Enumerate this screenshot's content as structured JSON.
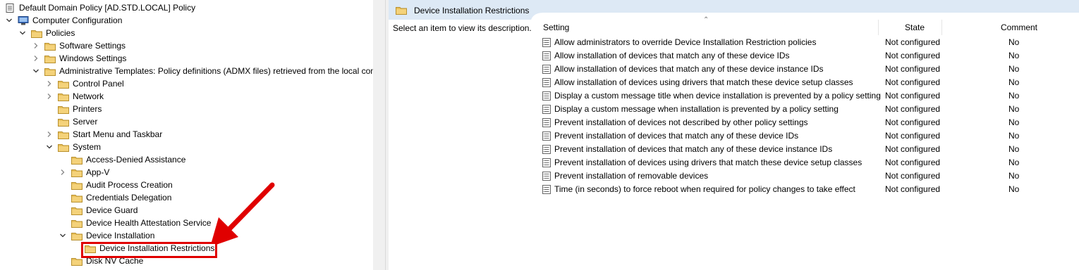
{
  "tree": {
    "items": [
      {
        "label": "Default Domain Policy [AD.STD.LOCAL] Policy",
        "icon": "policy-doc-icon",
        "expander": "none",
        "name": "tree-item-default-domain-policy"
      },
      {
        "label": "Computer Configuration",
        "icon": "computer-icon",
        "expander": "open",
        "name": "tree-item-computer-configuration"
      },
      {
        "label": "Policies",
        "icon": "folder-icon",
        "expander": "open",
        "name": "tree-item-policies"
      },
      {
        "label": "Software Settings",
        "icon": "folder-icon",
        "expander": "closed",
        "name": "tree-item-software-settings"
      },
      {
        "label": "Windows Settings",
        "icon": "folder-icon",
        "expander": "closed",
        "name": "tree-item-windows-settings"
      },
      {
        "label": "Administrative Templates: Policy definitions (ADMX files) retrieved from the local computer",
        "icon": "folder-icon",
        "expander": "open",
        "name": "tree-item-administrative-templates"
      },
      {
        "label": "Control Panel",
        "icon": "folder-icon",
        "expander": "closed",
        "name": "tree-item-control-panel"
      },
      {
        "label": "Network",
        "icon": "folder-icon",
        "expander": "closed",
        "name": "tree-item-network"
      },
      {
        "label": "Printers",
        "icon": "folder-icon",
        "expander": "none",
        "name": "tree-item-printers"
      },
      {
        "label": "Server",
        "icon": "folder-icon",
        "expander": "none",
        "name": "tree-item-server"
      },
      {
        "label": "Start Menu and Taskbar",
        "icon": "folder-icon",
        "expander": "closed",
        "name": "tree-item-start-menu"
      },
      {
        "label": "System",
        "icon": "folder-icon",
        "expander": "open",
        "name": "tree-item-system"
      },
      {
        "label": "Access-Denied Assistance",
        "icon": "folder-icon",
        "expander": "none",
        "name": "tree-item-access-denied"
      },
      {
        "label": "App-V",
        "icon": "folder-icon",
        "expander": "closed",
        "name": "tree-item-app-v"
      },
      {
        "label": "Audit Process Creation",
        "icon": "folder-icon",
        "expander": "none",
        "name": "tree-item-audit-process"
      },
      {
        "label": "Credentials Delegation",
        "icon": "folder-icon",
        "expander": "none",
        "name": "tree-item-credentials-delegation"
      },
      {
        "label": "Device Guard",
        "icon": "folder-icon",
        "expander": "none",
        "name": "tree-item-device-guard"
      },
      {
        "label": "Device Health Attestation Service",
        "icon": "folder-icon",
        "expander": "none",
        "name": "tree-item-device-health"
      },
      {
        "label": "Device Installation",
        "icon": "folder-icon",
        "expander": "open",
        "name": "tree-item-device-installation"
      },
      {
        "label": "Device Installation Restrictions",
        "icon": "folder-icon",
        "expander": "none",
        "name": "tree-item-device-installation-restrictions"
      },
      {
        "label": "Disk NV Cache",
        "icon": "folder-icon",
        "expander": "none",
        "name": "tree-item-disk-nv-cache"
      }
    ]
  },
  "right": {
    "header_title": "Device Installation Restrictions",
    "description": "Select an item to view its description.",
    "columns": {
      "setting": "Setting",
      "state": "State",
      "comment": "Comment"
    },
    "rows": [
      {
        "setting": "Allow administrators to override Device Installation Restriction policies",
        "state": "Not configured",
        "comment": "No"
      },
      {
        "setting": "Allow installation of devices that match any of these device IDs",
        "state": "Not configured",
        "comment": "No"
      },
      {
        "setting": "Allow installation of devices that match any of these device instance IDs",
        "state": "Not configured",
        "comment": "No"
      },
      {
        "setting": "Allow installation of devices using drivers that match these device setup classes",
        "state": "Not configured",
        "comment": "No"
      },
      {
        "setting": "Display a custom message title when device installation is prevented by a policy setting",
        "state": "Not configured",
        "comment": "No"
      },
      {
        "setting": "Display a custom message when installation is prevented by a policy setting",
        "state": "Not configured",
        "comment": "No"
      },
      {
        "setting": "Prevent installation of devices not described by other policy settings",
        "state": "Not configured",
        "comment": "No"
      },
      {
        "setting": "Prevent installation of devices that match any of these device IDs",
        "state": "Not configured",
        "comment": "No"
      },
      {
        "setting": "Prevent installation of devices that match any of these device instance IDs",
        "state": "Not configured",
        "comment": "No"
      },
      {
        "setting": "Prevent installation of devices using drivers that match these device setup classes",
        "state": "Not configured",
        "comment": "No"
      },
      {
        "setting": "Prevent installation of removable devices",
        "state": "Not configured",
        "comment": "No"
      },
      {
        "setting": "Time (in seconds) to force reboot when required for policy changes to take effect",
        "state": "Not configured",
        "comment": "No"
      }
    ]
  },
  "annotation": {
    "highlight_color": "#e00000",
    "arrow_icon": "red-arrow-icon"
  },
  "colors": {
    "folder": "#e8c05a",
    "header_bg": "#dde9f5",
    "splitter": "#f0f0f0"
  }
}
